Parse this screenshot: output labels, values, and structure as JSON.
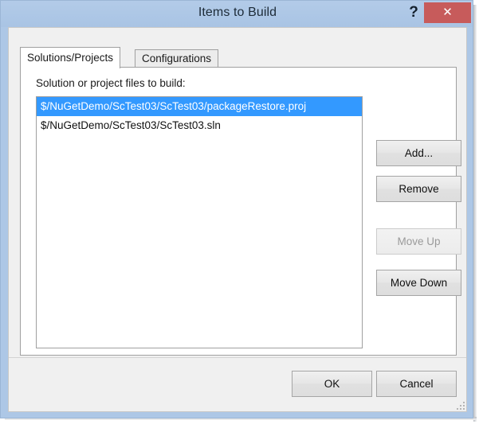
{
  "window": {
    "title": "Items to Build",
    "help_glyph": "?",
    "close_glyph": "✕",
    "titlebar_color": "#adc7e6",
    "close_button_color": "#c75b5b"
  },
  "tabs": [
    {
      "label": "Solutions/Projects",
      "active": true
    },
    {
      "label": "Configurations",
      "active": false
    }
  ],
  "main": {
    "field_label": "Solution or project files to build:",
    "list": {
      "items": [
        {
          "text": "$/NuGetDemo/ScTest03/ScTest03/packageRestore.proj",
          "selected": true
        },
        {
          "text": "$/NuGetDemo/ScTest03/ScTest03.sln",
          "selected": false
        }
      ],
      "selection_color": "#3399ff"
    },
    "side_buttons": [
      {
        "label": "Add...",
        "enabled": true
      },
      {
        "label": "Remove",
        "enabled": true
      },
      {
        "label": "Move Up",
        "enabled": false
      },
      {
        "label": "Move Down",
        "enabled": true
      }
    ]
  },
  "footer": {
    "ok_label": "OK",
    "cancel_label": "Cancel"
  }
}
